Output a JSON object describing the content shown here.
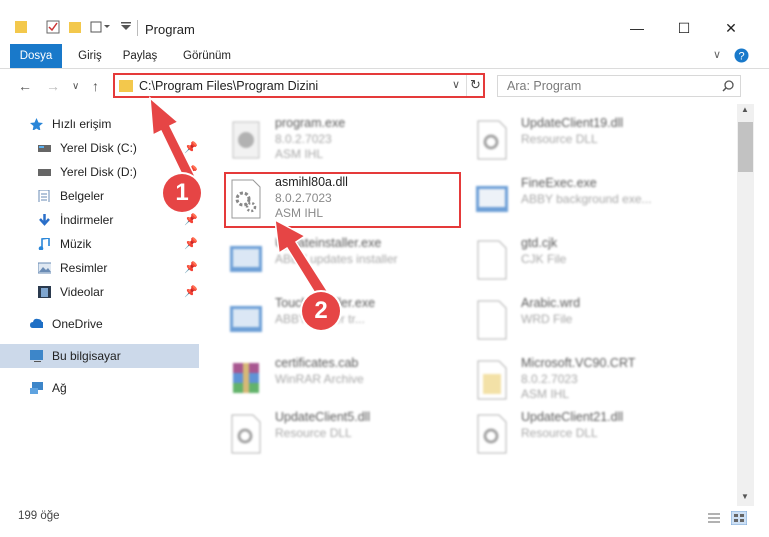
{
  "window": {
    "title": "Program",
    "controls": [
      "—",
      "☐",
      "✕"
    ]
  },
  "ribbon": {
    "tabs": [
      "Dosya",
      "Giriş",
      "Paylaş",
      "Görünüm"
    ]
  },
  "address": {
    "path": "C:\\Program Files\\Program Dizini",
    "search_placeholder": "Ara: Program"
  },
  "sidebar": {
    "items": [
      {
        "label": "Hızlı erişim",
        "icon": "star-icon"
      },
      {
        "label": "Yerel Disk (C:)",
        "icon": "drive-icon",
        "pinned": true
      },
      {
        "label": "Yerel Disk (D:)",
        "icon": "drive-icon",
        "pinned": true
      },
      {
        "label": "Belgeler",
        "icon": "documents-icon",
        "pinned": true
      },
      {
        "label": "İndirmeler",
        "icon": "download-icon",
        "pinned": true
      },
      {
        "label": "Müzik",
        "icon": "music-icon",
        "pinned": true
      },
      {
        "label": "Resimler",
        "icon": "pictures-icon",
        "pinned": true
      },
      {
        "label": "Videolar",
        "icon": "video-icon",
        "pinned": true
      },
      {
        "label": "OneDrive",
        "icon": "cloud-icon"
      },
      {
        "label": "Bu bilgisayar",
        "icon": "computer-icon"
      },
      {
        "label": "Ağ",
        "icon": "network-icon"
      }
    ]
  },
  "files": {
    "left": [
      {
        "name": "program.exe",
        "l2": "8.0.2.7023",
        "l3": "ASM IHL"
      },
      {
        "name": "asmihl80a.dll",
        "l2": "8.0.2.7023",
        "l3": "ASM IHL"
      },
      {
        "name": "Updateinstaller.exe",
        "l2": "ABBY updates installer",
        "l3": ""
      },
      {
        "name": "TouchInstaller.exe",
        "l2": "ABBY reader tr...",
        "l3": ""
      },
      {
        "name": "certificates.cab",
        "l2": "WinRAR Archive",
        "l3": ""
      },
      {
        "name": "UpdateClient5.dll",
        "l2": "Resource DLL",
        "l3": ""
      }
    ],
    "right": [
      {
        "name": "UpdateClient19.dll",
        "l2": "Resource DLL",
        "l3": ""
      },
      {
        "name": "FineExec.exe",
        "l2": "ABBY background exe...",
        "l3": ""
      },
      {
        "name": "gtd.cjk",
        "l2": "CJK File",
        "l3": ""
      },
      {
        "name": "Arabic.wrd",
        "l2": "WRD File",
        "l3": ""
      },
      {
        "name": "Microsoft.VC90.CRT",
        "l2": "8.0.2.7023",
        "l3": "ASM IHL"
      },
      {
        "name": "UpdateClient21.dll",
        "l2": "Resource DLL",
        "l3": ""
      }
    ]
  },
  "annotations": {
    "badge1": "1",
    "badge2": "2"
  },
  "status": {
    "count": "199 öğe"
  }
}
